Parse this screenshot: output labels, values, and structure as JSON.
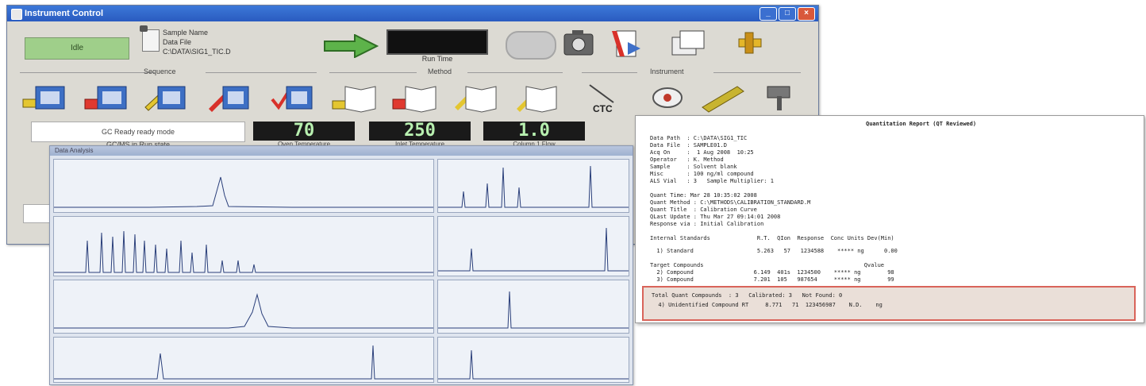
{
  "window": {
    "title": "Instrument Control",
    "buttons": [
      "_",
      "□",
      "×"
    ],
    "status": "Idle",
    "sample": {
      "line1": "Sample Name",
      "line2": "Data File",
      "line3": "C:\\DATA\\SIG1_TIC.D"
    },
    "run_label": "Run Time",
    "groups": [
      "Sequence",
      "Method",
      "Instrument"
    ],
    "readout_text": "GC Ready ready mode",
    "readout_sub": "GC/MS in Run state",
    "readouts": [
      {
        "value": "70",
        "label": "Oven Temperature"
      },
      {
        "value": "250",
        "label": "Inlet Temperature"
      },
      {
        "value": "1.0",
        "label": "Column 1 Flow"
      }
    ],
    "icon_labels": [
      "CTC"
    ]
  },
  "chromatograms": {
    "title": "Data Analysis"
  },
  "report": {
    "title": "Quantitation Report    (QT Reviewed)",
    "lines_top": [
      "Data Path  : C:\\DATA\\SIG1_TIC",
      "Data File  : SAMPLE01.D",
      "Acq On     :  1 Aug 2008  10:25",
      "Operator   : K. Method",
      "Sample     : Solvent blank",
      "Misc       : 100 ng/ml compound",
      "ALS Vial   : 3   Sample Multiplier: 1"
    ],
    "lines_mid": [
      "Quant Time: Mar 28 10:35:02 2008",
      "Quant Method : C:\\METHODS\\CALIBRATION_STANDARD.M",
      "Quant Title  : Calibration Curve",
      "QLast Update : Thu Mar 27 09:14:01 2008",
      "Response via : Initial Calibration"
    ],
    "table_header": "Internal Standards              R.T.  QIon  Response  Conc Units Dev(Min)",
    "table_row1": "  1) Standard                   5.263   57   1234588    ***** ng      0.00",
    "target_header": "Target Compounds                                                Qvalue",
    "target_rows": [
      "  2) Compound                  6.149  401s  1234500    ***** ng        98",
      "  3) Compound                  7.201  105   987654     ***** ng        99"
    ],
    "hl_lines": [
      "Total Quant Compounds  : 3   Calibrated: 3   Not Found: 0",
      "  4) Unidentified Compound RT     8.771   71  123456987    N.D.    ng"
    ]
  }
}
